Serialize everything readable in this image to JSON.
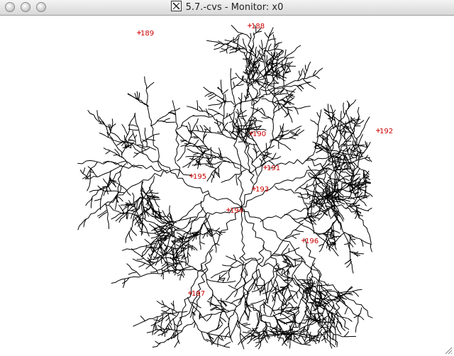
{
  "window": {
    "title": "5.7.-cvs - Monitor: x0",
    "app_icon": "x11-icon"
  },
  "titlebar_buttons": [
    {
      "name": "close-button",
      "icon": "circle-button"
    },
    {
      "name": "minimize-button",
      "icon": "circle-button"
    },
    {
      "name": "zoom-button",
      "icon": "circle-button"
    }
  ],
  "colors": {
    "network": "#000000",
    "labels": "#cc0000",
    "background": "#ffffff"
  },
  "monitor_points": [
    {
      "id": "188",
      "label": "188"
    },
    {
      "id": "189",
      "label": "189"
    },
    {
      "id": "190",
      "label": "190"
    },
    {
      "id": "191",
      "label": "191"
    },
    {
      "id": "192",
      "label": "192"
    },
    {
      "id": "193",
      "label": "193"
    },
    {
      "id": "194",
      "label": "194"
    },
    {
      "id": "195",
      "label": "195"
    },
    {
      "id": "196",
      "label": "196"
    },
    {
      "id": "197",
      "label": "197"
    }
  ]
}
